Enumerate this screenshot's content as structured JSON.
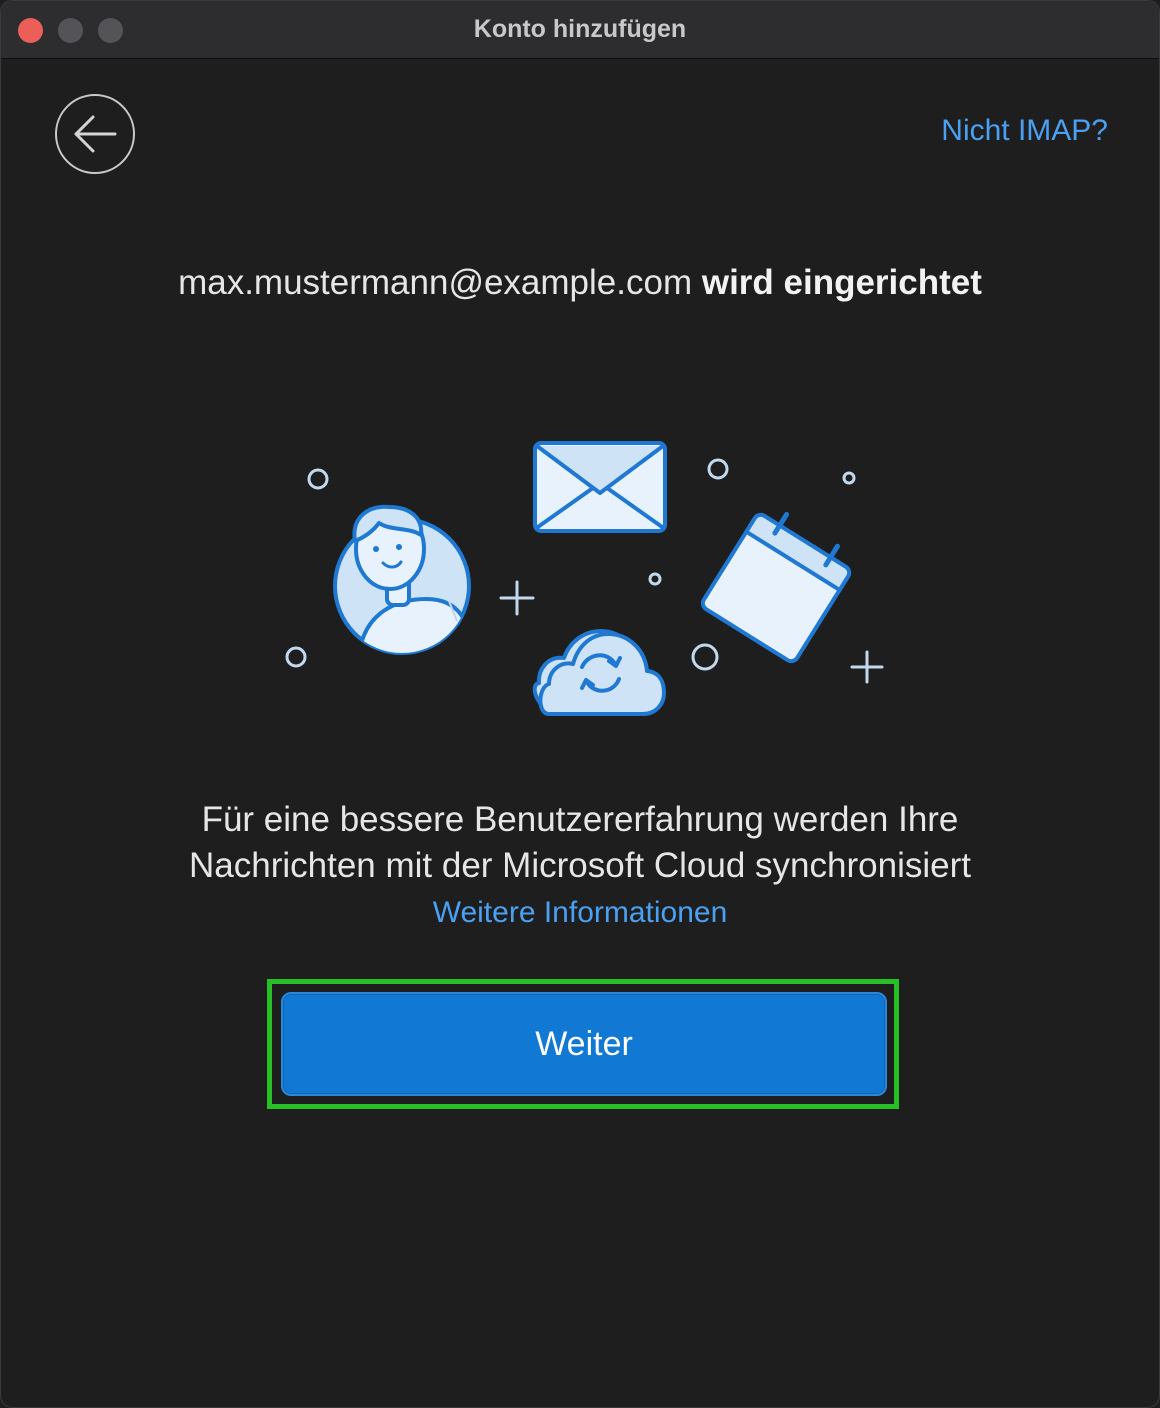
{
  "window": {
    "title": "Konto hinzufügen"
  },
  "header": {
    "back_icon": "arrow-left-icon",
    "not_imap_link": "Nicht IMAP?"
  },
  "setup": {
    "email": "max.mustermann@example.com",
    "status_text": "wird eingerichtet"
  },
  "illustration": {
    "icons": [
      "user-avatar-icon",
      "mail-envelope-icon",
      "calendar-icon",
      "cloud-sync-icon"
    ],
    "accent_color": "#1f78d1",
    "fill_color": "#cfe3f7"
  },
  "info": {
    "line1": "Für eine bessere Benutzererfahrung werden Ihre",
    "line2": "Nachrichten mit der Microsoft Cloud synchronisiert",
    "more_info_link": "Weitere Informationen"
  },
  "actions": {
    "continue_label": "Weiter"
  },
  "colors": {
    "background": "#1e1e1e",
    "link": "#4aa0f2",
    "primary_button": "#1178d4",
    "highlight": "#26c026"
  }
}
